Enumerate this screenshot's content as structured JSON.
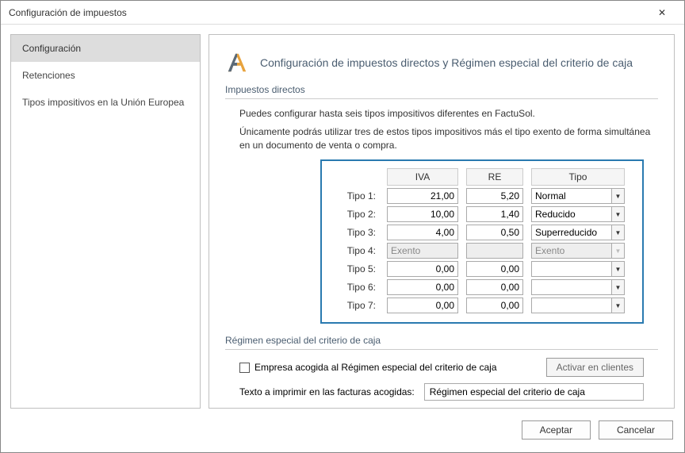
{
  "window": {
    "title": "Configuración de impuestos"
  },
  "sidebar": {
    "items": [
      {
        "label": "Configuración"
      },
      {
        "label": "Retenciones"
      },
      {
        "label": "Tipos impositivos en la Unión Europea"
      }
    ]
  },
  "header": {
    "title": "Configuración de impuestos directos y Régimen especial del criterio de caja"
  },
  "section_direct": {
    "title": "Impuestos directos",
    "desc1": "Puedes configurar hasta seis tipos impositivos diferentes en FactuSol.",
    "desc2": "Únicamente podrás utilizar tres de estos tipos impositivos más el tipo exento de forma simultánea en un documento de venta o compra."
  },
  "table": {
    "col_iva": "IVA",
    "col_re": "RE",
    "col_tipo": "Tipo",
    "rows": [
      {
        "label": "Tipo 1:",
        "iva": "21,00",
        "re": "5,20",
        "tipo": "Normal",
        "disabled": false
      },
      {
        "label": "Tipo 2:",
        "iva": "10,00",
        "re": "1,40",
        "tipo": "Reducido",
        "disabled": false
      },
      {
        "label": "Tipo 3:",
        "iva": "4,00",
        "re": "0,50",
        "tipo": "Superreducido",
        "disabled": false
      },
      {
        "label": "Tipo 4:",
        "iva": "Exento",
        "re": "",
        "tipo": "Exento",
        "disabled": true
      },
      {
        "label": "Tipo 5:",
        "iva": "0,00",
        "re": "0,00",
        "tipo": "",
        "disabled": false
      },
      {
        "label": "Tipo 6:",
        "iva": "0,00",
        "re": "0,00",
        "tipo": "",
        "disabled": false
      },
      {
        "label": "Tipo 7:",
        "iva": "0,00",
        "re": "0,00",
        "tipo": "",
        "disabled": false
      }
    ]
  },
  "section_regimen": {
    "title": "Régimen especial del criterio de caja",
    "checkbox_label": "Empresa acogida al Régimen especial del criterio de caja",
    "activate_btn": "Activar en clientes",
    "print_label": "Texto a imprimir en las facturas acogidas:",
    "print_value": "Régimen especial del criterio de caja"
  },
  "footer": {
    "accept": "Aceptar",
    "cancel": "Cancelar"
  }
}
